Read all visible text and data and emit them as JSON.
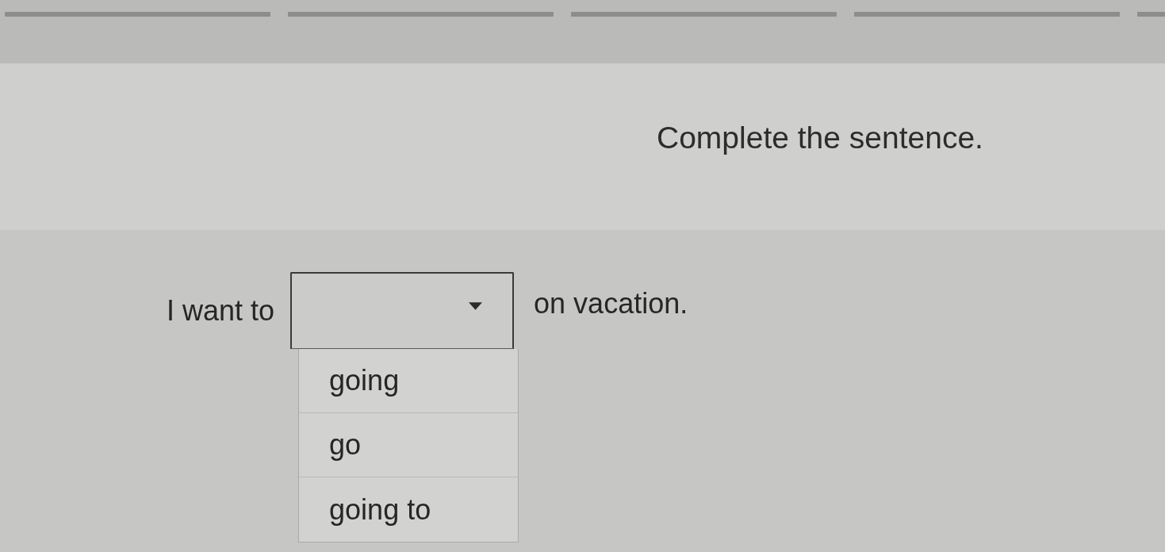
{
  "prompt": "Complete the sentence.",
  "sentence": {
    "before": "I want to",
    "after": "on vacation."
  },
  "dropdown": {
    "expanded": true,
    "options": [
      {
        "label": "going",
        "selected": false
      },
      {
        "label": "go",
        "selected": false
      },
      {
        "label": "going to",
        "selected": false
      }
    ]
  }
}
